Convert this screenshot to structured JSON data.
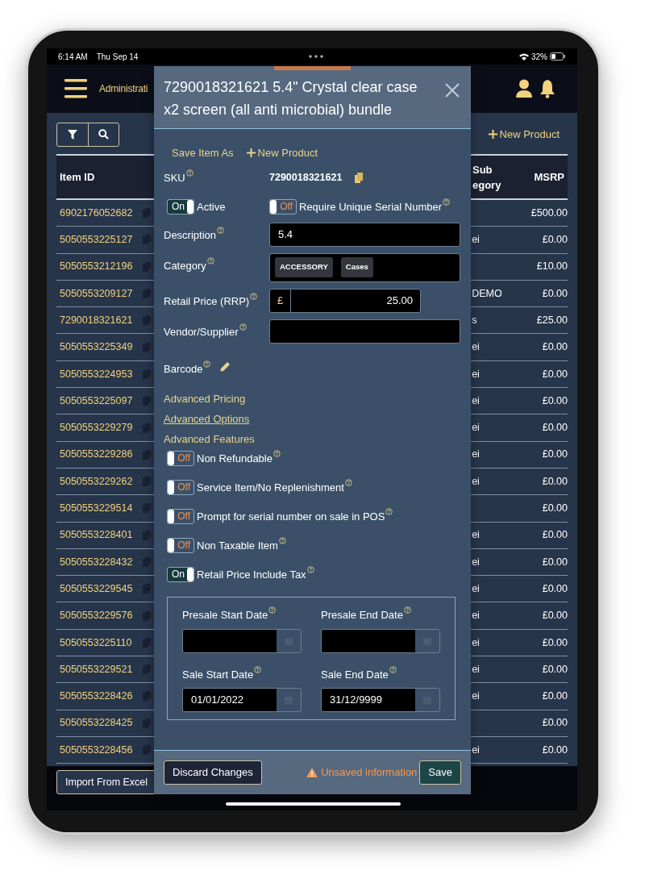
{
  "status_bar": {
    "time": "6:14 AM",
    "date": "Thu Sep 14",
    "battery": "32%"
  },
  "nav": {
    "title": "Administrati"
  },
  "toolbar": {
    "new_product": "New Product"
  },
  "table": {
    "columns": [
      {
        "label": "Item ID"
      },
      {
        "label": "Sub\negory"
      },
      {
        "label": "MSRP"
      }
    ],
    "rows": [
      {
        "item_id": "6902176052682",
        "msrp": "£500.00"
      },
      {
        "item_id": "5050553225127",
        "sub_category": "ei",
        "msrp": "£0.00"
      },
      {
        "item_id": "5050553212196",
        "msrp": "£10.00"
      },
      {
        "item_id": "5050553209127",
        "sub_category": "DEMO",
        "msrp": "£0.00"
      },
      {
        "item_id": "7290018321621",
        "sub_category": "s",
        "msrp": "£25.00"
      },
      {
        "item_id": "5050553225349",
        "sub_category": "ei",
        "msrp": "£0.00"
      },
      {
        "item_id": "5050553224953",
        "sub_category": "ei",
        "msrp": "£0.00"
      },
      {
        "item_id": "5050553225097",
        "sub_category": "ei",
        "msrp": "£0.00"
      },
      {
        "item_id": "5050553229279",
        "sub_category": "ei",
        "msrp": "£0.00"
      },
      {
        "item_id": "5050553229286",
        "sub_category": "ei",
        "msrp": "£0.00"
      },
      {
        "item_id": "5050553229262",
        "sub_category": "ei",
        "msrp": "£0.00"
      },
      {
        "item_id": "5050553229514",
        "msrp": "£0.00"
      },
      {
        "item_id": "5050553228401",
        "sub_category": "ei",
        "msrp": "£0.00"
      },
      {
        "item_id": "5050553228432",
        "sub_category": "ei",
        "msrp": "£0.00"
      },
      {
        "item_id": "5050553229545",
        "sub_category": "ei",
        "msrp": "£0.00"
      },
      {
        "item_id": "5050553229576",
        "sub_category": "ei",
        "msrp": "£0.00"
      },
      {
        "item_id": "5050553225110",
        "sub_category": "ei",
        "msrp": "£0.00"
      },
      {
        "item_id": "5050553229521",
        "sub_category": "ei",
        "msrp": "£0.00"
      },
      {
        "item_id": "5050553228426",
        "sub_category": "ei",
        "msrp": "£0.00"
      },
      {
        "item_id": "5050553228425",
        "msrp": "£0.00"
      },
      {
        "item_id": "5050553228456",
        "sub_category": "ei",
        "msrp": "£0.00"
      }
    ]
  },
  "bottom_bar": {
    "import": "Import From Excel"
  },
  "dialog": {
    "title": "7290018321621 5.4\" Crystal clear case x2 screen (all anti microbial) bundle",
    "actions": [
      {
        "label": "Save Item As",
        "kind": "plain"
      },
      {
        "label": "New Product",
        "kind": "add"
      }
    ],
    "sku": {
      "label": "SKU",
      "help": true,
      "value": "7290018321621"
    },
    "switches": [
      {
        "label": "Active",
        "on": true,
        "text": "On",
        "help": false
      },
      {
        "label": "Require Unique Serial Number",
        "on": false,
        "text": "Off",
        "help": true
      }
    ],
    "fields": [
      {
        "label": "Description",
        "help": true,
        "kind": "text",
        "value": "5.4"
      },
      {
        "label": "Category",
        "help": true,
        "kind": "tags",
        "tags": [
          "ACCESSORY",
          "Cases"
        ]
      },
      {
        "label": "Retail Price (RRP)",
        "help": true,
        "kind": "price",
        "prefix": "£",
        "value": "25.00"
      },
      {
        "label": "Vendor/Supplier",
        "help": true,
        "kind": "text"
      },
      {
        "label": "Barcode",
        "help": true,
        "kind": "edit"
      }
    ],
    "sections": [
      {
        "label": "Advanced Pricing",
        "selected": false
      },
      {
        "label": "Advanced Options",
        "selected": true
      },
      {
        "label": "Advanced Features",
        "selected": false
      }
    ],
    "features": [
      {
        "label": "Non Refundable",
        "on": false,
        "text": "Off",
        "help": true
      },
      {
        "label": "Service Item/No Replenishment",
        "on": false,
        "text": "Off",
        "help": true
      },
      {
        "label": "Prompt for serial number on sale in POS",
        "on": false,
        "text": "Off",
        "help": true
      },
      {
        "label": "Non Taxable Item",
        "on": false,
        "text": "Off",
        "help": true
      },
      {
        "label": "Retail Price Include Tax",
        "on": true,
        "text": "On",
        "help": true
      }
    ],
    "dates": [
      {
        "label": "Presale Start Date",
        "help": true
      },
      {
        "label": "Presale End Date",
        "help": true
      },
      {
        "label": "Sale Start Date",
        "help": true,
        "value": "01/01/2022"
      },
      {
        "label": "Sale End Date",
        "help": true,
        "value": "31/12/9999"
      }
    ],
    "footer": {
      "discard": "Discard Changes",
      "warning": "Unsaved information",
      "save": "Save"
    }
  }
}
